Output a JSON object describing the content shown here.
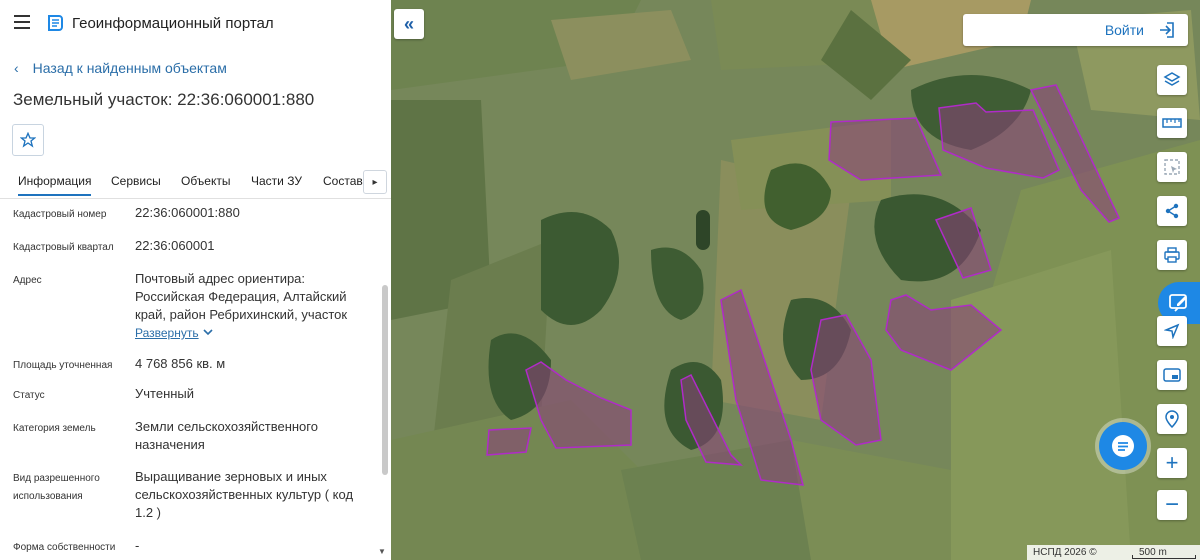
{
  "header": {
    "title": "Геоинформационный портал"
  },
  "nav": {
    "back_label": "Назад к найденным объектам"
  },
  "page": {
    "title": "Земельный участок: 22:36:060001:880"
  },
  "tabs": [
    {
      "label": "Информация",
      "active": true
    },
    {
      "label": "Сервисы",
      "active": false
    },
    {
      "label": "Объекты",
      "active": false
    },
    {
      "label": "Части ЗУ",
      "active": false
    },
    {
      "label": "Состав",
      "active": false
    }
  ],
  "info": {
    "cadastral_number": {
      "label": "Кадастровый номер",
      "value": "22:36:060001:880"
    },
    "cadastral_quarter": {
      "label": "Кадастровый квартал",
      "value": "22:36:060001"
    },
    "address": {
      "label": "Адрес",
      "lines": [
        "Почтовый адрес ориентира:",
        "Российская Федерация, Алтайский",
        "край, район Ребрихинский, участок"
      ],
      "expand_label": "Развернуть"
    },
    "area": {
      "label": "Площадь уточненная",
      "value": "4 768 856 кв. м"
    },
    "status": {
      "label": "Статус",
      "value": "Учтенный"
    },
    "land_category": {
      "label": "Категория земель",
      "lines": [
        "Земли сельскохозяйственного",
        "назначения"
      ]
    },
    "permitted_use": {
      "label_lines": [
        "Вид разрешенного",
        "использования"
      ],
      "lines": [
        "Выращивание зерновых и иных",
        "сельскохозяйственных культур ( код",
        "1.2 )"
      ]
    },
    "ownership": {
      "label": "Форма собственности",
      "value": "-"
    }
  },
  "map": {
    "login_label": "Войти",
    "attribution": "НСПД 2026 ©",
    "scale_label": "500 m",
    "colors": {
      "parcel_stroke": "#b02bc8",
      "parcel_fill": "#8a3f7a",
      "accent": "#1e73be"
    },
    "tools": [
      "layers-icon",
      "ruler-icon",
      "select-area-icon",
      "share-icon",
      "print-icon",
      "locate-icon",
      "minimap-icon",
      "geotag-icon",
      "zoom-in-icon",
      "zoom-out-icon"
    ]
  }
}
